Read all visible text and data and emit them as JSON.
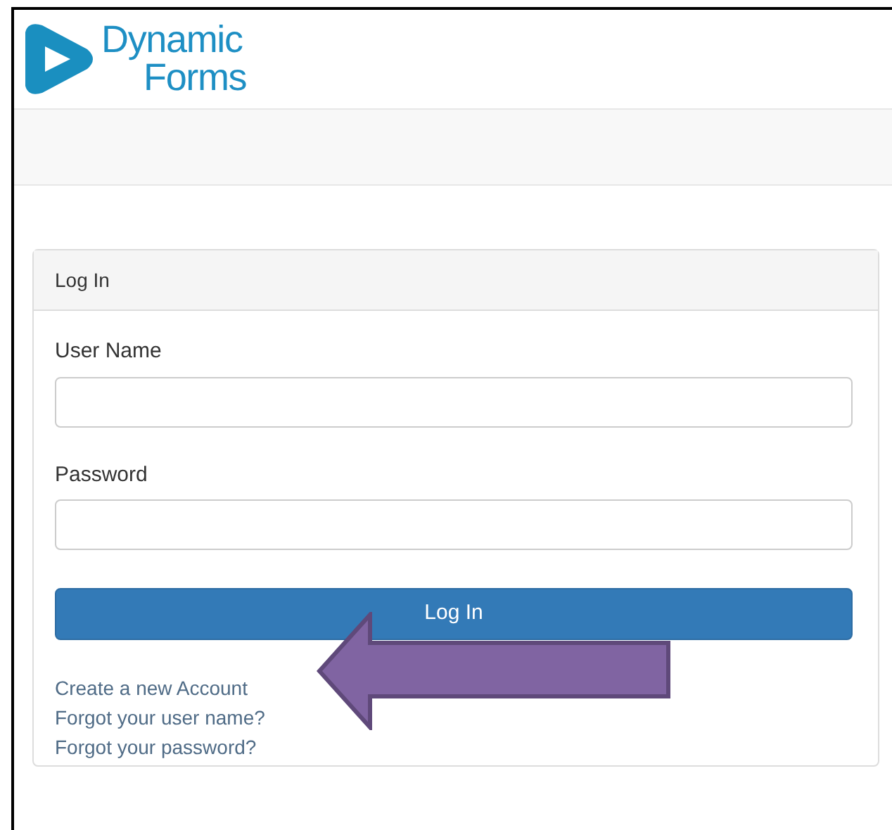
{
  "logo": {
    "line_1": "Dynamic",
    "line_2": "Forms"
  },
  "panel": {
    "title": "Log In"
  },
  "fields": [
    {
      "label": "User Name"
    },
    {
      "label": "Password"
    }
  ],
  "submit_button": "Log In",
  "links": [
    "Create a new Account",
    "Forgot your user name?",
    "Forgot your password?"
  ]
}
